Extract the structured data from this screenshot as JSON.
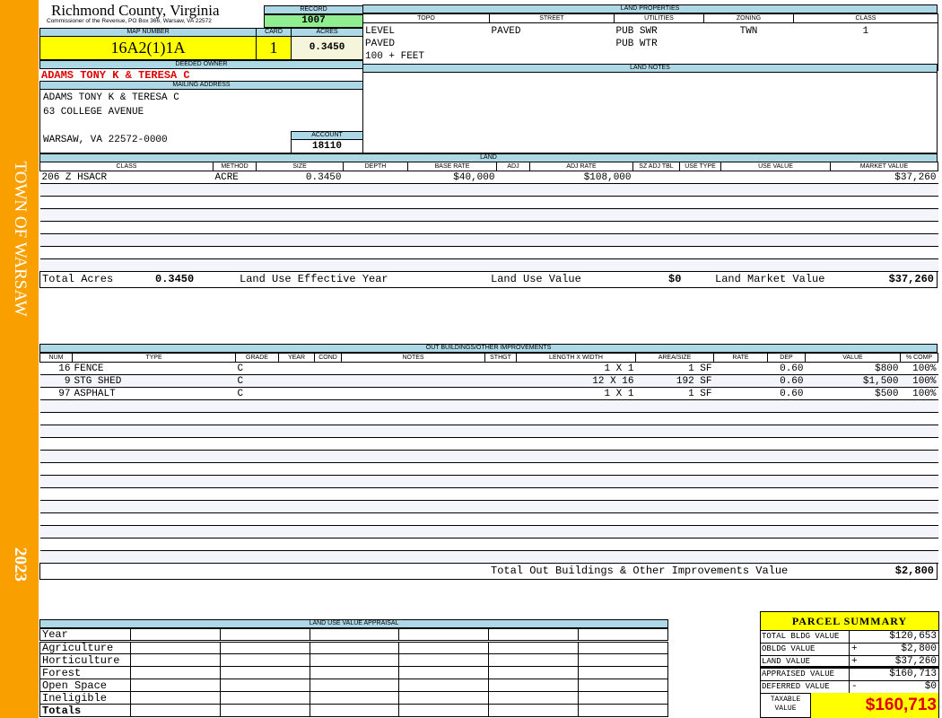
{
  "sidebar": {
    "town": "TOWN OF WARSAW",
    "year": "2023",
    "color": "#f9a000"
  },
  "header": {
    "title": "Richmond County, Virginia",
    "subtitle": "Commissioner of the Revenue, PO Box 366, Warsaw, VA 22572"
  },
  "record": {
    "label": "RECORD",
    "value": "1007"
  },
  "map": {
    "label": "MAP NUMBER",
    "value": "16A2(1)1A"
  },
  "card": {
    "label": "CARD",
    "value": "1"
  },
  "acres": {
    "label": "ACRES",
    "value": "0.3450"
  },
  "owner": {
    "label": "DEEDED OWNER",
    "name": "ADAMS TONY K & TERESA C"
  },
  "mailing": {
    "label": "MAILING ADDRESS",
    "lines": [
      "ADAMS TONY K & TERESA C",
      "63 COLLEGE AVENUE",
      "",
      "WARSAW, VA 22572-0000"
    ]
  },
  "account": {
    "label": "ACCOUNT",
    "value": "18110"
  },
  "land_properties": {
    "label": "LAND PROPERTIES",
    "columns": [
      "TOPO",
      "STREET",
      "UTILITIES",
      "ZONING",
      "CLASS"
    ],
    "topo": [
      "LEVEL",
      "PAVED",
      "100 + FEET"
    ],
    "street": [
      "PAVED"
    ],
    "utilities": [
      "PUB SWR",
      "PUB WTR"
    ],
    "zoning": [
      "TWN"
    ],
    "class": [
      "1"
    ]
  },
  "land_notes": {
    "label": "LAND NOTES"
  },
  "land": {
    "label": "LAND",
    "columns": [
      "CLASS",
      "METHOD",
      "SIZE",
      "DEPTH",
      "BASE RATE",
      "ADJ",
      "ADJ RATE",
      "SZ ADJ TBL",
      "USE TYPE",
      "USE VALUE",
      "MARKET VALUE"
    ],
    "rows": [
      [
        "206 Z HSACR",
        "ACRE",
        "0.3450",
        "",
        "$40,000",
        "",
        "$108,000",
        "",
        "",
        "",
        "$37,260"
      ]
    ],
    "totals": {
      "total_acres_label": "Total Acres",
      "total_acres": "0.3450",
      "effective_year_label": "Land Use Effective Year",
      "use_value_label": "Land Use Value",
      "use_value": "$0",
      "market_value_label": "Land Market Value",
      "market_value": "$37,260"
    }
  },
  "outbuildings": {
    "label": "OUT BUILDINGS/OTHER IMPROVEMENTS",
    "columns": [
      "NUM",
      "TYPE",
      "GRADE",
      "YEAR",
      "COND",
      "NOTES",
      "STHGT",
      "LENGTH X WIDTH",
      "AREA/SIZE",
      "RATE",
      "DEP",
      "VALUE",
      "% COMP"
    ],
    "rows": [
      [
        "16",
        "FENCE",
        "C",
        "",
        "",
        "",
        "",
        "1 X 1",
        "1 SF",
        "",
        "0.60",
        "$800",
        "100%"
      ],
      [
        "9",
        "STG SHED",
        "C",
        "",
        "",
        "",
        "",
        "12 X 16",
        "192 SF",
        "",
        "0.60",
        "$1,500",
        "100%"
      ],
      [
        "97",
        "ASPHALT",
        "C",
        "",
        "",
        "",
        "",
        "1 X 1",
        "1 SF",
        "",
        "0.60",
        "$500",
        "100%"
      ]
    ],
    "total_label": "Total Out Buildings & Other Improvements Value",
    "total": "$2,800"
  },
  "land_use_appraisal": {
    "label": "LAND USE VALUE APPRAISAL",
    "year_label": "Year",
    "rows": [
      "Agriculture",
      "Horticulture",
      "Forest",
      "Open Space",
      "Ineligible"
    ],
    "totals_label": "Totals"
  },
  "parcel_summary": {
    "title": "PARCEL SUMMARY",
    "rows": [
      {
        "label": "TOTAL BLDG VALUE",
        "sign": "",
        "value": "$120,653"
      },
      {
        "label": "OBLDG VALUE",
        "sign": "+",
        "value": "$2,800"
      },
      {
        "label": "LAND VALUE",
        "sign": "+",
        "value": "$37,260"
      },
      {
        "label": "APPRAISED VALUE",
        "sign": "",
        "value": "$160,713"
      },
      {
        "label": "DEFERRED VALUE",
        "sign": "-",
        "value": "$0"
      }
    ],
    "taxable_label": "TAXABLE VALUE",
    "taxable": "$160,713"
  }
}
